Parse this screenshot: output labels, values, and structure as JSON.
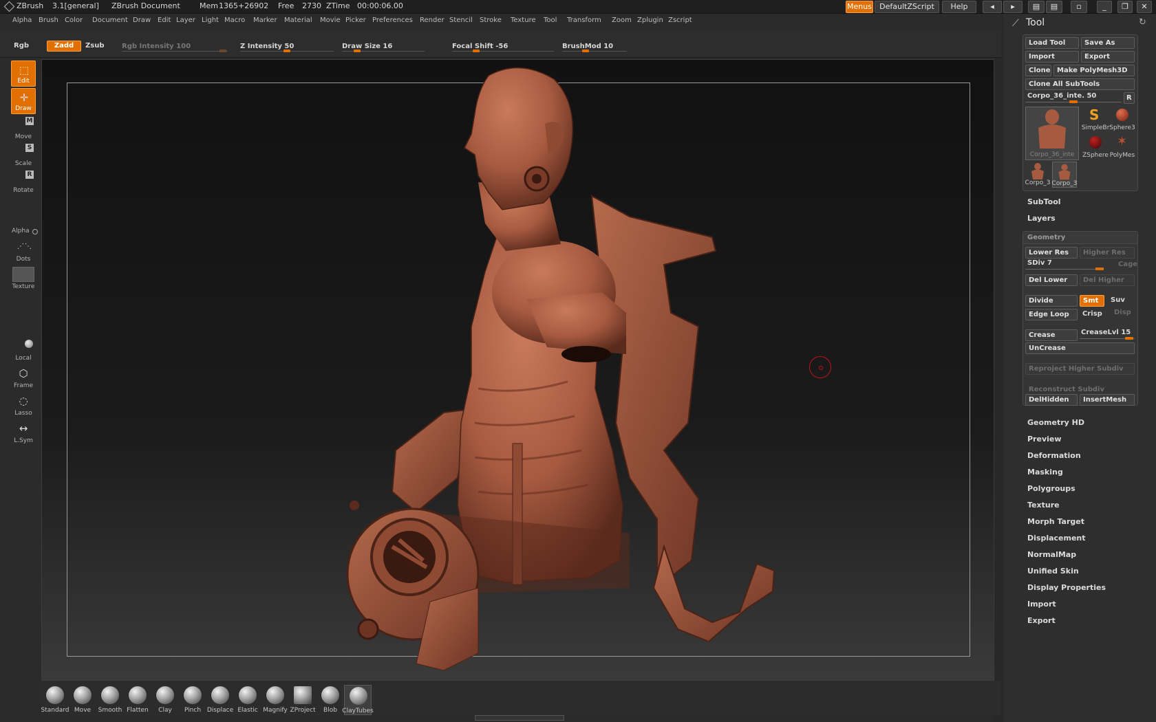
{
  "app": {
    "name": "ZBrush",
    "version": "3.1[general]",
    "document": "ZBrush Document",
    "mem_label": "Mem",
    "mem_value": "1365+26902",
    "free_label": "Free",
    "free_value": "2730",
    "ztime_label": "ZTime",
    "ztime_value": "00:00:06.00"
  },
  "titlebar_buttons": {
    "menus": "Menus",
    "script": "DefaultZScript",
    "help": "Help"
  },
  "menu": [
    "Alpha",
    "Brush",
    "Color",
    "Document",
    "Draw",
    "Edit",
    "Layer",
    "Light",
    "Macro",
    "Marker",
    "Material",
    "Movie",
    "Picker",
    "Preferences",
    "Render",
    "Stencil",
    "Stroke",
    "Texture",
    "Tool",
    "Transform",
    "Zoom",
    "Zplugin",
    "Zscript"
  ],
  "shelf": {
    "rgb": "Rgb",
    "zadd": "Zadd",
    "zsub": "Zsub",
    "rgb_intensity": "Rgb Intensity 100",
    "z_intensity": "Z Intensity 50",
    "draw_size": "Draw Size 16",
    "focal_shift": "Focal Shift -56",
    "brushmod": "BrushMod 10",
    "z_intensity_level": 0.5,
    "draw_size_level": 0.15,
    "focal_shift_level": 0.22,
    "brushmod_level": 0.35
  },
  "left_tools": {
    "edit": "Edit",
    "draw": "Draw",
    "move": "Move",
    "move_key": "M",
    "scale": "Scale",
    "scale_key": "S",
    "rotate": "Rotate",
    "rotate_key": "R",
    "alpha": "Alpha",
    "dots": "Dots",
    "texture": "Texture",
    "local": "Local",
    "frame": "Frame",
    "lasso": "Lasso",
    "lsym": "L.Sym"
  },
  "brushes": [
    "Standard",
    "Move",
    "Smooth",
    "Flatten",
    "Clay",
    "Pinch",
    "Displace",
    "Elastic",
    "Magnify",
    "ZProject",
    "Blob",
    "ClayTubes"
  ],
  "selected_brush": "ClayTubes",
  "tool_panel": {
    "title": "Tool",
    "load_tool": "Load Tool",
    "save_as": "Save As",
    "import": "Import",
    "export": "Export",
    "clone": "Clone",
    "make_polymesh": "Make PolyMesh3D",
    "clone_all": "Clone All SubTools",
    "current_tool_slider": "Corpo_36_inte. 50",
    "current_tool_level": 0.5,
    "r_button": "R",
    "thumbs": {
      "main": "Corpo_36_inte",
      "simplebrush": "SimpleBr",
      "sphere3d": "Sphere3",
      "zsphere": "ZSphere",
      "polymesh": "PolyMes",
      "corpo_a": "Corpo_3",
      "corpo_b": "Corpo_3"
    },
    "subtool": "SubTool",
    "layers": "Layers",
    "geometry": {
      "header": "Geometry",
      "lower_res": "Lower Res",
      "higher_res": "Higher Res",
      "sdiv": "SDiv 7",
      "sdiv_level": 1.0,
      "cage": "Cage",
      "del_lower": "Del Lower",
      "del_higher": "Del Higher",
      "divide": "Divide",
      "smt": "Smt",
      "suv": "Suv",
      "edge_loop": "Edge Loop",
      "crisp": "Crisp",
      "disp": "Disp",
      "crease": "Crease",
      "crease_lvl": "CreaseLvl 15",
      "uncrease": "UnCrease",
      "reproject": "Reproject Higher Subdiv",
      "reconstruct": "Reconstruct Subdiv",
      "delhidden": "DelHidden",
      "insertmesh": "InsertMesh"
    },
    "sections": [
      "Geometry HD",
      "Preview",
      "Deformation",
      "Masking",
      "Polygroups",
      "Texture",
      "Morph Target",
      "Displacement",
      "NormalMap",
      "Unified Skin",
      "Display Properties",
      "Import",
      "Export"
    ]
  },
  "colors": {
    "accent": "#e27000",
    "model": "#a65a40",
    "cursor": "#c0101a"
  }
}
